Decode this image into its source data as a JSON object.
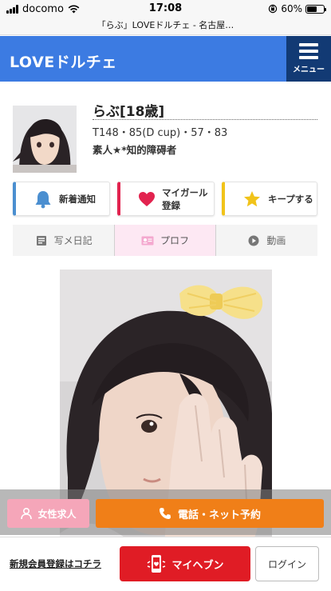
{
  "status_bar": {
    "carrier": "docomo",
    "time": "17:08",
    "battery": "60%",
    "battery_level": 0.6
  },
  "browser": {
    "url_title": "「らぶ」LOVEドルチェ - 名古屋…"
  },
  "header": {
    "logo": "LOVEドルチェ",
    "menu_label": "メニュー",
    "color": "#3c7be2",
    "menu_color": "#123a74"
  },
  "profile": {
    "name": "らぶ[18歳]",
    "stats": "T148・85(D cup)・57・83",
    "tagline": "素人★*知的障碍者"
  },
  "actions": {
    "notify": "新着通知",
    "mygirl": "マイガール登録",
    "keep": "キープする"
  },
  "tabs": [
    {
      "label": "写メ日記",
      "icon": "diary-icon"
    },
    {
      "label": "プロフ",
      "icon": "profile-card-icon",
      "active": true
    },
    {
      "label": "動画",
      "icon": "play-icon"
    }
  ],
  "bottom": {
    "recruit": "女性求人",
    "reserve": "電話・ネット予約",
    "register": "新規会員登録はコチラ",
    "myheaven": "マイヘブン",
    "login": "ログイン"
  },
  "colors": {
    "notify_accent": "#4b8fd0",
    "mygirl_accent": "#e2234f",
    "keep_accent": "#f1c319",
    "recruit_bg": "#f5a6b9",
    "reserve_bg": "#f07f18",
    "myheaven_bg": "#e01c25"
  }
}
